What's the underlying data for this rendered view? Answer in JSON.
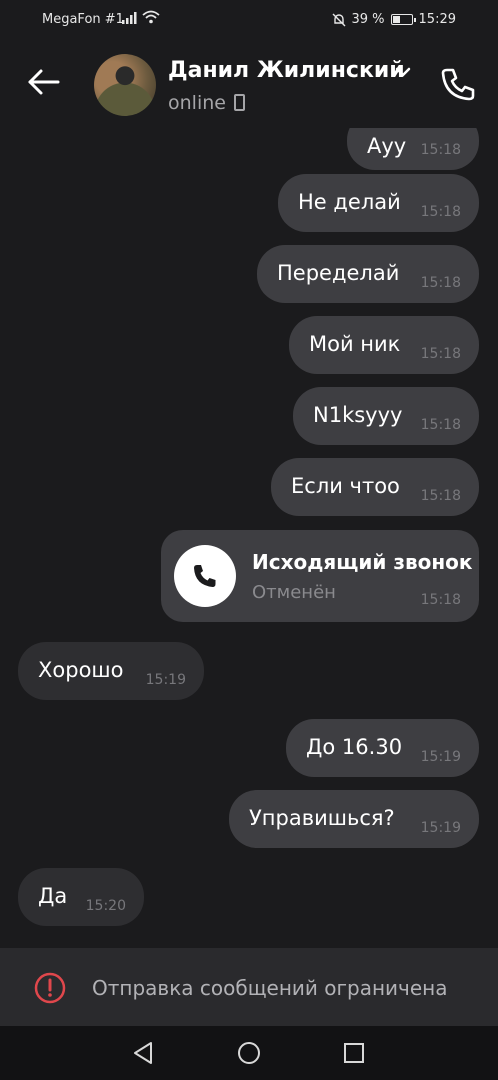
{
  "status_bar": {
    "carrier": "MegaFon #1",
    "battery": "39 %",
    "battery_level": 0.39,
    "time": "15:29",
    "icons": [
      "signal-icon",
      "wifi-icon",
      "silent-bell-icon",
      "battery-icon"
    ]
  },
  "header": {
    "contact_name": "Данил Жилинский",
    "status": "online",
    "icons": [
      "back-arrow-icon",
      "chevron-down-icon",
      "mobile-device-icon",
      "phone-icon"
    ]
  },
  "messages": [
    {
      "text": "Ауу",
      "time": "15:18",
      "direction": "out"
    },
    {
      "text": "Не делай",
      "time": "15:18",
      "direction": "out"
    },
    {
      "text": "Переделай",
      "time": "15:18",
      "direction": "out"
    },
    {
      "text": "Мой ник",
      "time": "15:18",
      "direction": "out"
    },
    {
      "text": "N1ksyyy",
      "time": "15:18",
      "direction": "out"
    },
    {
      "text": "Если чтоо",
      "time": "15:18",
      "direction": "out"
    },
    {
      "text": "Хорошо",
      "time": "15:19",
      "direction": "in"
    },
    {
      "text": "До 16.30",
      "time": "15:19",
      "direction": "out"
    },
    {
      "text": "Управишься?",
      "time": "15:19",
      "direction": "out"
    },
    {
      "text": "Да",
      "time": "15:20",
      "direction": "in"
    }
  ],
  "call": {
    "title": "Исходящий звонок",
    "status": "Отменён",
    "time": "15:18",
    "icon": "phone-icon"
  },
  "restriction": {
    "text": "Отправка сообщений ограничена",
    "icon": "alert-circle-icon",
    "color": "#e0474c"
  },
  "nav": {
    "icons": [
      "nav-back-icon",
      "nav-home-icon",
      "nav-recents-icon"
    ]
  },
  "colors": {
    "background": "#1b1b1d",
    "outgoing_bubble": "#3e3e42",
    "incoming_bubble": "#2e2e31"
  }
}
